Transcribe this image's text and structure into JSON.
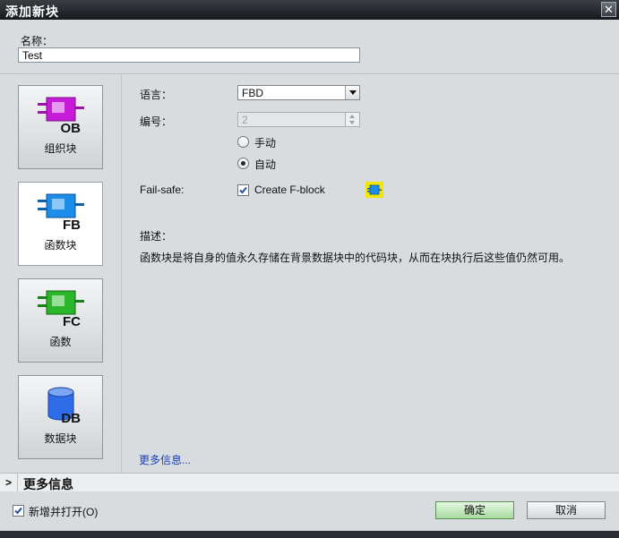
{
  "window": {
    "title": "添加新块",
    "close_label": "✕"
  },
  "name_field": {
    "label": "名称：",
    "value": "Test"
  },
  "block_types": [
    {
      "icon": "ob-block-icon",
      "badge": "OB",
      "label": "组织块",
      "selected": false
    },
    {
      "icon": "fb-block-icon",
      "badge": "FB",
      "label": "函数块",
      "selected": true
    },
    {
      "icon": "fc-block-icon",
      "badge": "FC",
      "label": "函数",
      "selected": false
    },
    {
      "icon": "db-block-icon",
      "badge": "DB",
      "label": "数据块",
      "selected": false
    }
  ],
  "form": {
    "language": {
      "label": "语言：",
      "value": "FBD"
    },
    "number": {
      "label": "编号：",
      "value": "2"
    },
    "numbering": {
      "manual_label": "手动",
      "auto_label": "自动",
      "selected": "auto"
    },
    "failsafe": {
      "label": "Fail-safe:",
      "checkbox_label": "Create F-block",
      "checked": true
    },
    "description": {
      "label": "描述：",
      "text": "函数块是将自身的值永久存储在背景数据块中的代码块，从而在块执行后这些值仍然可用。"
    },
    "more_info_link": "更多信息..."
  },
  "more_info_bar": {
    "label": "更多信息"
  },
  "footer": {
    "add_and_open": {
      "label": "新增并打开(O)",
      "checked": true
    },
    "ok_label": "确定",
    "cancel_label": "取消"
  },
  "colors": {
    "ob": "#c61bd8",
    "fb": "#1c8de8",
    "fc": "#2bb52b",
    "db": "#2f6de8",
    "title_bar": "#1e2226",
    "ok_button": "#a8d9a0"
  }
}
